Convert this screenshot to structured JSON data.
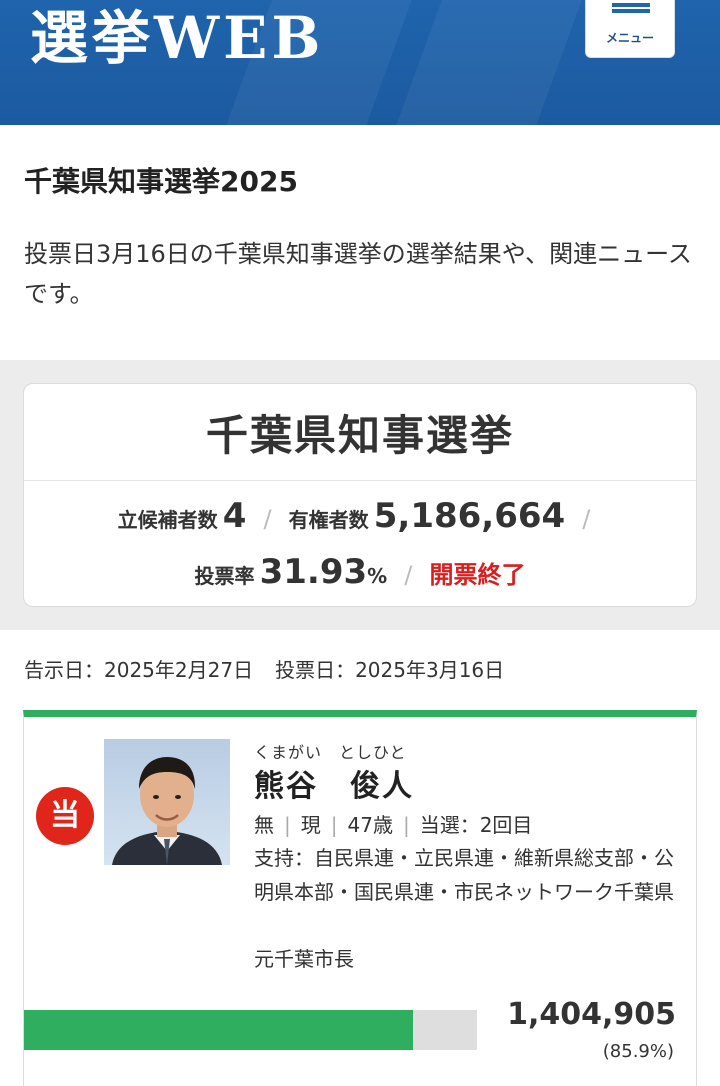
{
  "header": {
    "logo_text": "選挙WEB",
    "menu_label": "メニュー"
  },
  "page": {
    "title": "千葉県知事選挙2025",
    "description": "投票日3月16日の千葉県知事選挙の選挙結果や、関連ニュースです。"
  },
  "summary": {
    "title": "千葉県知事選挙",
    "candidates_label": "立候補者数",
    "candidates_value": "4",
    "voters_label": "有権者数",
    "voters_value": "5,186,664",
    "sep": "/",
    "turnout_label": "投票率",
    "turnout_value": "31.93",
    "turnout_unit": "%",
    "status": "開票終了"
  },
  "dates": {
    "announce": "告示日：2025年2月27日",
    "vote": "投票日：2025年3月16日"
  },
  "candidate": {
    "badge": "当",
    "furigana": "くまがい　としひと",
    "name": "熊谷　俊人",
    "party": "無",
    "status": "現",
    "age": "47歳",
    "elected": "当選：2回目",
    "support": "支持：自民県連・立民県連・維新県総支部・公明県本部・国民県連・市民ネットワーク千葉県",
    "title": "元千葉市長",
    "votes": "1,404,905",
    "share_text": "(85.9%)",
    "share": 0.859,
    "meta_sep": "|"
  },
  "colors": {
    "header_blue": "#1f64ad",
    "win_red": "#e0251b",
    "bar_green": "#2fae5f",
    "status_red": "#d81e1e"
  },
  "icons": {
    "menu": "hamburger-icon"
  }
}
